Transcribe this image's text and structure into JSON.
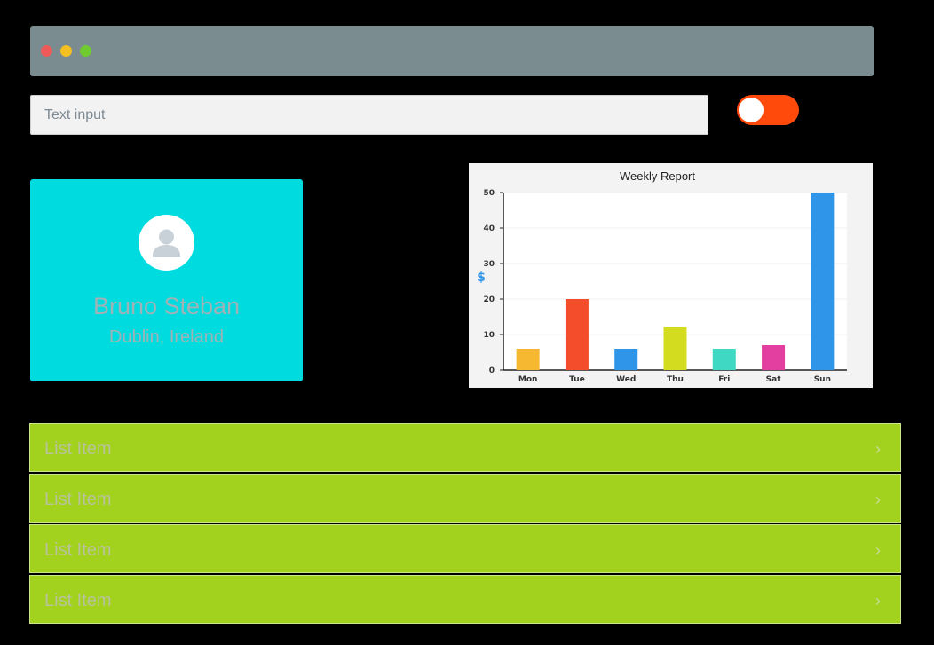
{
  "window": {
    "controls": [
      "close",
      "minimize",
      "maximize"
    ]
  },
  "search": {
    "placeholder": "Text input",
    "value": ""
  },
  "toggle": {
    "state": "on"
  },
  "profile": {
    "name": "Bruno Steban",
    "location": "Dublin, Ireland",
    "avatar_icon": "user-icon"
  },
  "colors": {
    "titlebar": "#7a8c90",
    "toggle": "#ff4a0b",
    "card": "#00dbdf",
    "list": "#a2d11e"
  },
  "chart_data": {
    "type": "bar",
    "title": "Weekly Report",
    "ylabel": "$",
    "xlabel": "",
    "categories": [
      "Mon",
      "Tue",
      "Wed",
      "Thu",
      "Fri",
      "Sat",
      "Sun"
    ],
    "values": [
      6,
      20,
      6,
      12,
      6,
      7,
      50
    ],
    "bar_colors": [
      "#f6b731",
      "#f44d2b",
      "#2f95e8",
      "#d4dc1f",
      "#3ed8c3",
      "#e23fa0",
      "#2f95e8"
    ],
    "ylim": [
      0,
      50
    ],
    "yticks": [
      0,
      10,
      20,
      30,
      40,
      50
    ],
    "grid": true,
    "legend": "none"
  },
  "list": {
    "items": [
      {
        "label": "List Item"
      },
      {
        "label": "List Item"
      },
      {
        "label": "List Item"
      },
      {
        "label": "List Item"
      }
    ]
  }
}
